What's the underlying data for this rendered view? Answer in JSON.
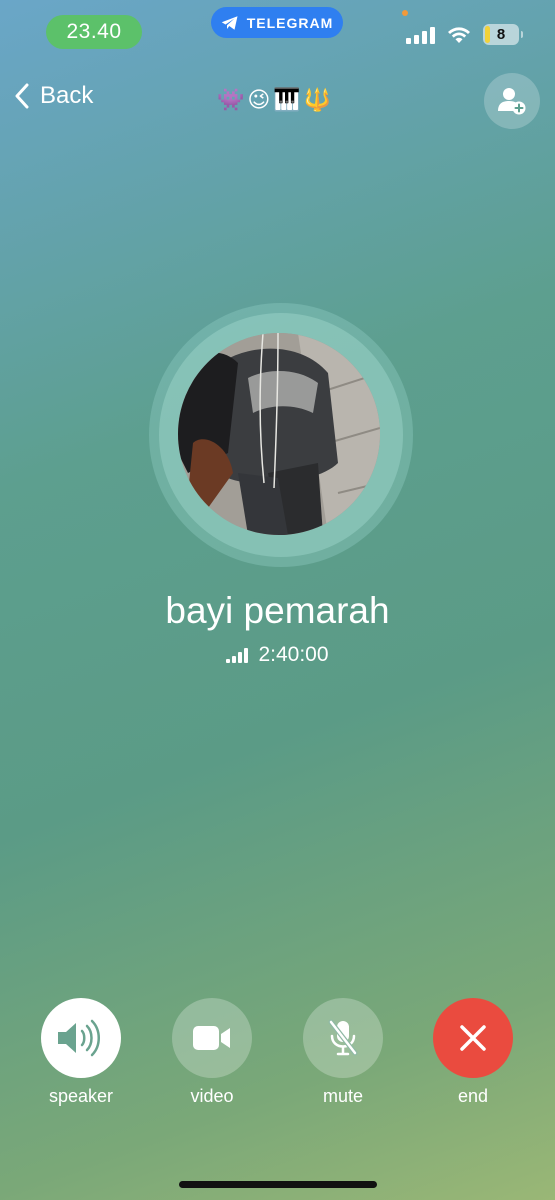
{
  "status_bar": {
    "time": "23.40",
    "app_pill": "TELEGRAM",
    "battery": "8"
  },
  "header": {
    "back_label": "Back",
    "title_emojis": [
      "👾",
      "😉",
      "🎹",
      "🔱"
    ]
  },
  "call": {
    "name": "bayi pemarah",
    "duration": "2:40:00"
  },
  "controls": {
    "speaker": "speaker",
    "video": "video",
    "mute": "mute",
    "end": "end"
  },
  "colors": {
    "end_button": "#ea4b3f",
    "time_pill": "#5cc16a",
    "telegram_pill": "#2f7ff0",
    "speaker_active": "#ffffff"
  }
}
